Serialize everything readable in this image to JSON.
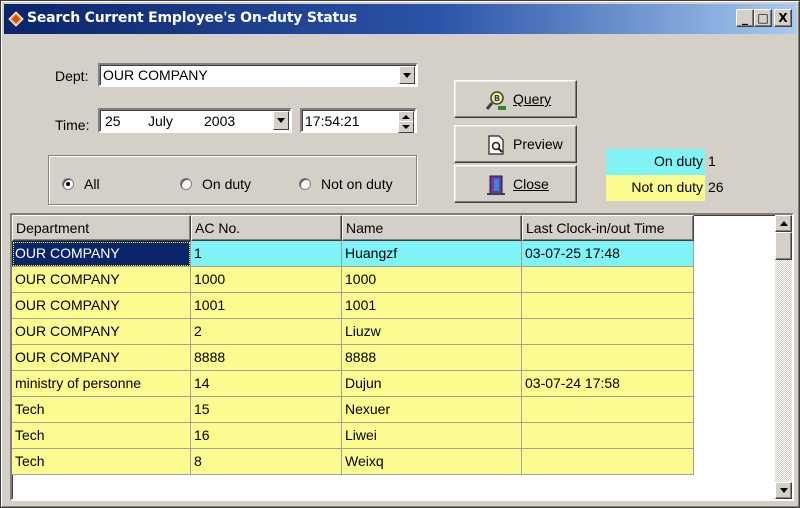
{
  "window": {
    "title": "Search Current Employee's On-duty Status",
    "buttons": {
      "minimize": "_",
      "maximize": "□",
      "close": "X"
    }
  },
  "filters": {
    "dept_label": "Dept:",
    "dept_value": "OUR COMPANY",
    "time_label": "Time:",
    "date_day": "25",
    "date_month": "July",
    "date_year": "2003",
    "time_value": "17:54:21"
  },
  "radios": [
    {
      "label": "All",
      "selected": true
    },
    {
      "label": "On duty",
      "selected": false
    },
    {
      "label": "Not on duty",
      "selected": false
    }
  ],
  "actions": {
    "query": "Query",
    "preview": "Preview",
    "close": "Close"
  },
  "legend": {
    "on_duty_label": "On duty",
    "on_duty_count": "1",
    "on_duty_color": "#7ff3f5",
    "not_on_duty_label": "Not on duty",
    "not_on_duty_count": "26",
    "not_on_duty_color": "#fbfb8f"
  },
  "table": {
    "columns": [
      "Department",
      "AC No.",
      "Name",
      "Last Clock-in/out Time"
    ],
    "rows": [
      {
        "cells": [
          "OUR COMPANY",
          "1",
          "Huangzf",
          "03-07-25 17:48"
        ],
        "status": "on"
      },
      {
        "cells": [
          "OUR COMPANY",
          "1000",
          "1000",
          ""
        ],
        "status": "off"
      },
      {
        "cells": [
          "OUR COMPANY",
          "1001",
          "1001",
          ""
        ],
        "status": "off"
      },
      {
        "cells": [
          "OUR COMPANY",
          "2",
          "Liuzw",
          ""
        ],
        "status": "off"
      },
      {
        "cells": [
          "OUR COMPANY",
          "8888",
          "8888",
          ""
        ],
        "status": "off"
      },
      {
        "cells": [
          "ministry of personne",
          "14",
          "Dujun",
          "03-07-24 17:58"
        ],
        "status": "off"
      },
      {
        "cells": [
          "Tech",
          "15",
          "Nexuer",
          ""
        ],
        "status": "off"
      },
      {
        "cells": [
          "Tech",
          "16",
          "Liwei",
          ""
        ],
        "status": "off"
      },
      {
        "cells": [
          "Tech",
          "8",
          "Weixq",
          ""
        ],
        "status": "off"
      }
    ]
  }
}
